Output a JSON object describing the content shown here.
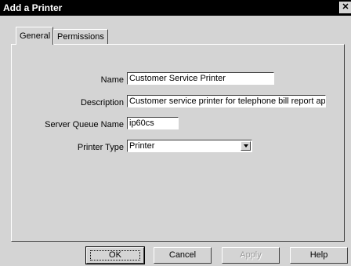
{
  "window": {
    "title": "Add a Printer",
    "close_icon": "close-icon"
  },
  "tabs": [
    {
      "label": "General",
      "active": true
    },
    {
      "label": "Permissions",
      "active": false
    }
  ],
  "form": {
    "name_label": "Name",
    "name_value": "Customer Service Printer",
    "description_label": "Description",
    "description_value": "Customer service printer for telephone bill report app",
    "queue_label": "Server Queue Name",
    "queue_value": "ip60cs",
    "type_label": "Printer Type",
    "type_value": "Printer"
  },
  "buttons": {
    "ok": "OK",
    "cancel": "Cancel",
    "apply": "Apply",
    "help": "Help"
  }
}
